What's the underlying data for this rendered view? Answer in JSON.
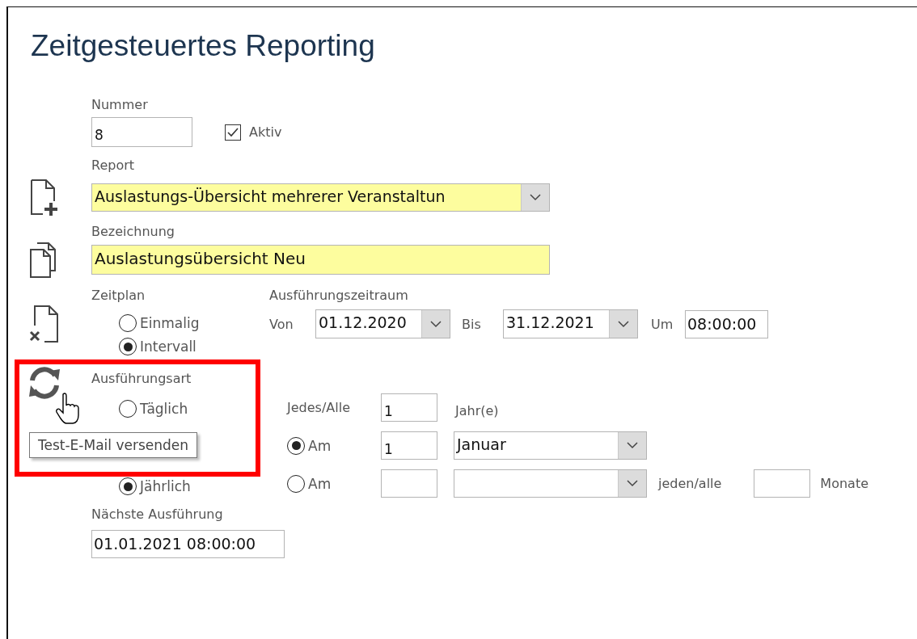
{
  "title": "Zeitgesteuertes Reporting",
  "nummer": {
    "label": "Nummer",
    "value": "8"
  },
  "aktiv": {
    "label": "Aktiv",
    "checked": true
  },
  "report": {
    "label": "Report",
    "value": "Auslastungs-Übersicht mehrerer Veranstaltun"
  },
  "bezeichnung": {
    "label": "Bezeichnung",
    "value": "Auslastungsübersicht Neu"
  },
  "zeitplan": {
    "label": "Zeitplan",
    "options": [
      {
        "label": "Einmalig",
        "selected": false
      },
      {
        "label": "Intervall",
        "selected": true
      }
    ]
  },
  "zeitraum": {
    "label": "Ausführungszeitraum",
    "von_label": "Von",
    "von": "01.12.2020",
    "bis_label": "Bis",
    "bis": "31.12.2021",
    "um_label": "Um",
    "um": "08:00:00"
  },
  "ausfuehrungsart": {
    "label": "Ausführungsart",
    "options": [
      {
        "label": "Täglich",
        "selected": false
      },
      {
        "kind": "covered"
      },
      {
        "kind": "covered"
      },
      {
        "label": "Jährlich",
        "selected": true
      }
    ]
  },
  "intervall": {
    "label": "Jedes/Alle",
    "value": "1",
    "unit": "Jahr(e)"
  },
  "am_rows": [
    {
      "label": "Am",
      "selected": true,
      "day": "1",
      "month": "Januar"
    },
    {
      "label": "Am",
      "selected": false,
      "every_label": "jeden/alle",
      "months_label": "Monate"
    }
  ],
  "naechste": {
    "label": "Nächste Ausführung",
    "value": "01.01.2021 08:00:00"
  },
  "toolbar": [
    {
      "kind": "new"
    },
    {
      "kind": "copy"
    },
    {
      "kind": "delete"
    },
    {
      "kind": "refresh"
    }
  ],
  "tooltip": "Test-E-Mail versenden"
}
